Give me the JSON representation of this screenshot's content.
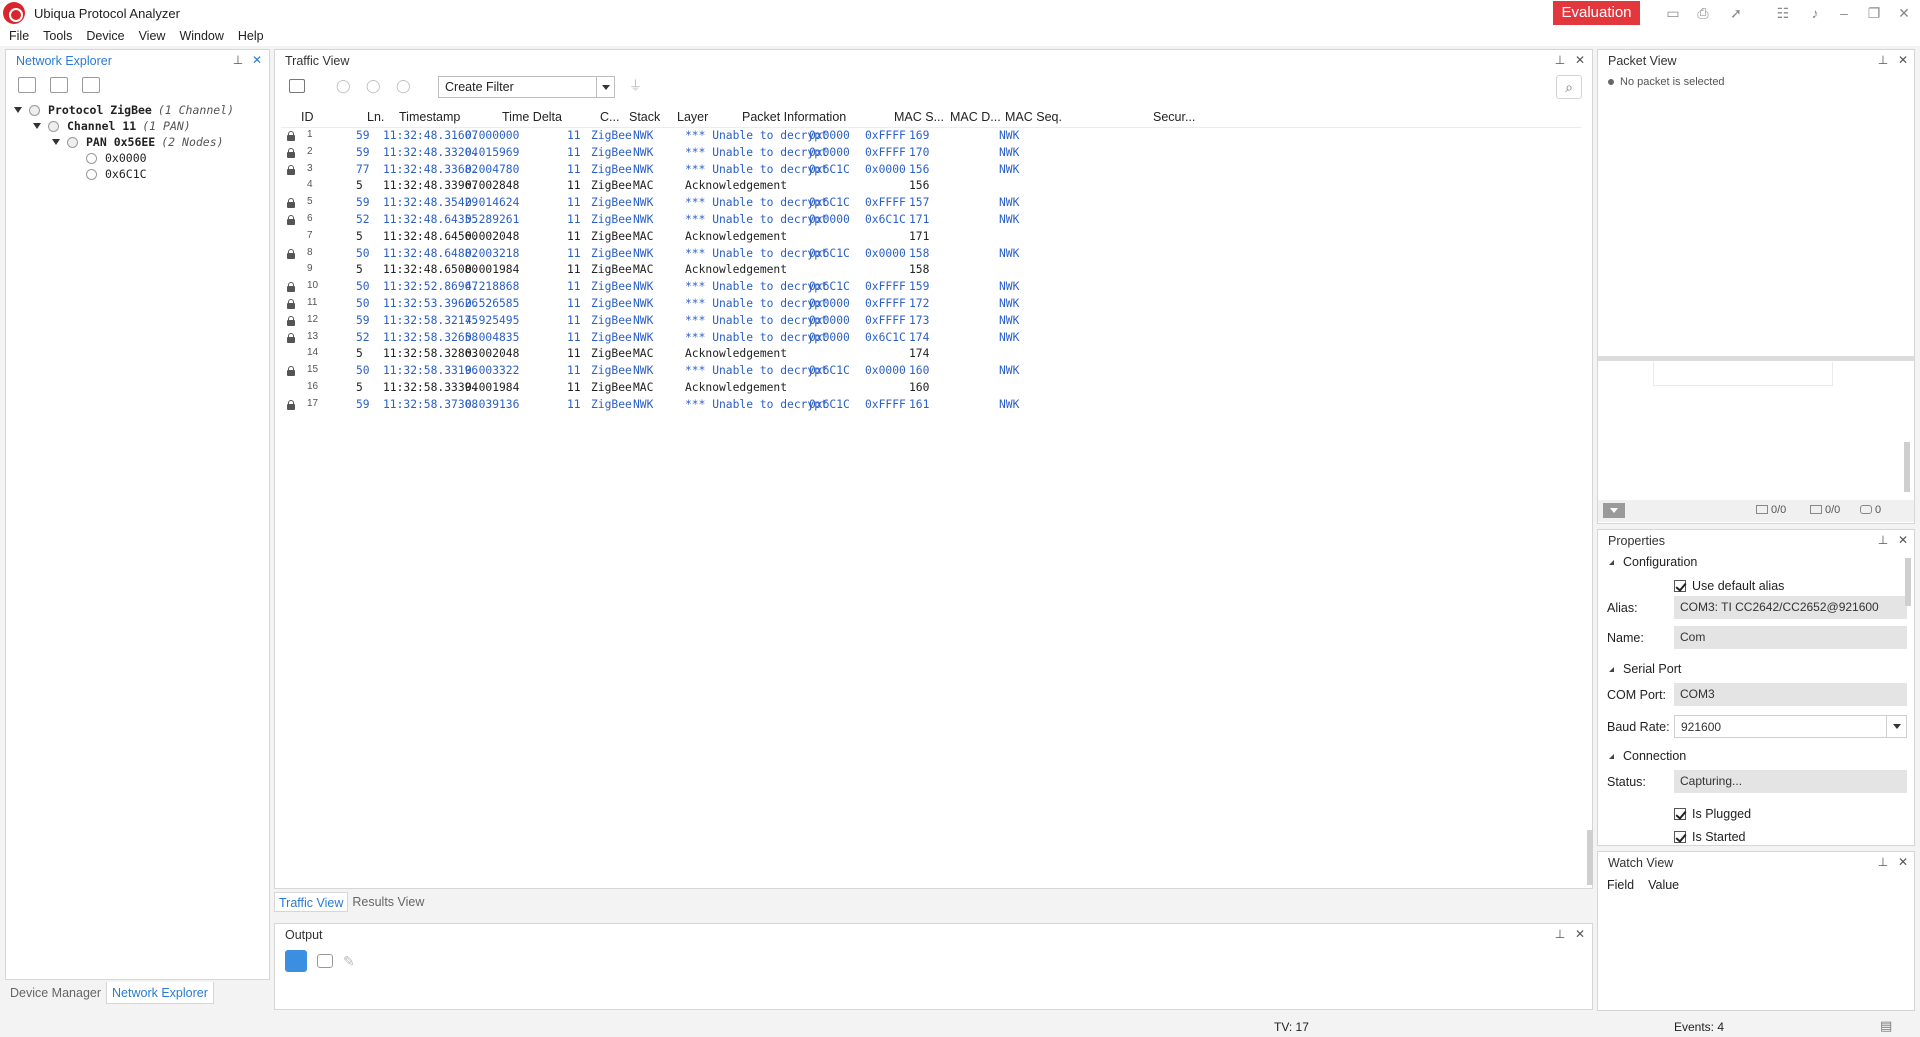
{
  "app": {
    "title": "Ubiqua Protocol Analyzer",
    "badge": "Evaluation",
    "accent_color": "#e2383d",
    "link_color": "#2a7ad5"
  },
  "menu": [
    "File",
    "Tools",
    "Device",
    "View",
    "Window",
    "Help"
  ],
  "network_explorer": {
    "title": "Network Explorer",
    "tree": {
      "protocol": {
        "name": "Protocol ZigBee",
        "meta": "(1 Channel)"
      },
      "channel": {
        "name": "Channel 11",
        "meta": "(1 PAN)"
      },
      "pan": {
        "name": "PAN 0x56EE",
        "meta": "(2 Nodes)"
      },
      "nodes": [
        "0x0000",
        "0x6C1C"
      ]
    }
  },
  "left_tabs": [
    "Device Manager",
    "Network Explorer"
  ],
  "traffic_view": {
    "title": "Traffic View",
    "filter_label": "Create Filter",
    "columns": [
      "ID",
      "Ln.",
      "Timestamp",
      "Time Delta",
      "C...",
      "Stack",
      "Layer",
      "Packet Information",
      "MAC S...",
      "MAC D...",
      "MAC Seq.",
      "Secur..."
    ],
    "rows": [
      {
        "id": "1",
        "locked": true,
        "len": "59",
        "ts": "11:32:48.31607",
        "delta": "0.000000",
        "ch": "11",
        "stack": "ZigBee",
        "layer": "NWK",
        "info": "*** Unable to decrypt…",
        "src": "0x0000",
        "dst": "0xFFFF",
        "seq": "169",
        "sec": "NWK"
      },
      {
        "id": "2",
        "locked": true,
        "len": "59",
        "ts": "11:32:48.33204",
        "delta": "0.015969",
        "ch": "11",
        "stack": "ZigBee",
        "layer": "NWK",
        "info": "*** Unable to decrypt…",
        "src": "0x0000",
        "dst": "0xFFFF",
        "seq": "170",
        "sec": "NWK"
      },
      {
        "id": "3",
        "locked": true,
        "len": "77",
        "ts": "11:32:48.33682",
        "delta": "0.004780",
        "ch": "11",
        "stack": "ZigBee",
        "layer": "NWK",
        "info": "*** Unable to decrypt…",
        "src": "0x6C1C",
        "dst": "0x0000",
        "seq": "156",
        "sec": "NWK"
      },
      {
        "id": "4",
        "locked": false,
        "len": "5",
        "ts": "11:32:48.33967",
        "delta": "0.002848",
        "ch": "11",
        "stack": "ZigBee",
        "layer": "MAC",
        "info": "Acknowledgement",
        "src": "",
        "dst": "",
        "seq": "156",
        "sec": ""
      },
      {
        "id": "5",
        "locked": true,
        "len": "59",
        "ts": "11:32:48.35429",
        "delta": "0.014624",
        "ch": "11",
        "stack": "ZigBee",
        "layer": "NWK",
        "info": "*** Unable to decrypt…",
        "src": "0x6C1C",
        "dst": "0xFFFF",
        "seq": "157",
        "sec": "NWK"
      },
      {
        "id": "6",
        "locked": true,
        "len": "52",
        "ts": "11:32:48.64355",
        "delta": "0.289261",
        "ch": "11",
        "stack": "ZigBee",
        "layer": "NWK",
        "info": "*** Unable to decrypt…",
        "src": "0x0000",
        "dst": "0x6C1C",
        "seq": "171",
        "sec": "NWK"
      },
      {
        "id": "7",
        "locked": false,
        "len": "5",
        "ts": "11:32:48.64560",
        "delta": "0.002048",
        "ch": "11",
        "stack": "ZigBee",
        "layer": "MAC",
        "info": "Acknowledgement",
        "src": "",
        "dst": "",
        "seq": "171",
        "sec": ""
      },
      {
        "id": "8",
        "locked": true,
        "len": "50",
        "ts": "11:32:48.64882",
        "delta": "0.003218",
        "ch": "11",
        "stack": "ZigBee",
        "layer": "NWK",
        "info": "*** Unable to decrypt…",
        "src": "0x6C1C",
        "dst": "0x0000",
        "seq": "158",
        "sec": "NWK"
      },
      {
        "id": "9",
        "locked": false,
        "len": "5",
        "ts": "11:32:48.65080",
        "delta": "0.001984",
        "ch": "11",
        "stack": "ZigBee",
        "layer": "MAC",
        "info": "Acknowledgement",
        "src": "",
        "dst": "",
        "seq": "158",
        "sec": ""
      },
      {
        "id": "10",
        "locked": true,
        "len": "50",
        "ts": "11:32:52.86967",
        "delta": "4.218868",
        "ch": "11",
        "stack": "ZigBee",
        "layer": "NWK",
        "info": "*** Unable to decrypt…",
        "src": "0x6C1C",
        "dst": "0xFFFF",
        "seq": "159",
        "sec": "NWK"
      },
      {
        "id": "11",
        "locked": true,
        "len": "50",
        "ts": "11:32:53.39626",
        "delta": "0.526585",
        "ch": "11",
        "stack": "ZigBee",
        "layer": "NWK",
        "info": "*** Unable to decrypt…",
        "src": "0x0000",
        "dst": "0xFFFF",
        "seq": "172",
        "sec": "NWK"
      },
      {
        "id": "12",
        "locked": true,
        "len": "59",
        "ts": "11:32:58.32175",
        "delta": "4.925495",
        "ch": "11",
        "stack": "ZigBee",
        "layer": "NWK",
        "info": "*** Unable to decrypt…",
        "src": "0x0000",
        "dst": "0xFFFF",
        "seq": "173",
        "sec": "NWK"
      },
      {
        "id": "13",
        "locked": true,
        "len": "52",
        "ts": "11:32:58.32658",
        "delta": "0.004835",
        "ch": "11",
        "stack": "ZigBee",
        "layer": "NWK",
        "info": "*** Unable to decrypt…",
        "src": "0x0000",
        "dst": "0x6C1C",
        "seq": "174",
        "sec": "NWK"
      },
      {
        "id": "14",
        "locked": false,
        "len": "5",
        "ts": "11:32:58.32863",
        "delta": "0.002048",
        "ch": "11",
        "stack": "ZigBee",
        "layer": "MAC",
        "info": "Acknowledgement",
        "src": "",
        "dst": "",
        "seq": "174",
        "sec": ""
      },
      {
        "id": "15",
        "locked": true,
        "len": "50",
        "ts": "11:32:58.33196",
        "delta": "0.003322",
        "ch": "11",
        "stack": "ZigBee",
        "layer": "NWK",
        "info": "*** Unable to decrypt…",
        "src": "0x6C1C",
        "dst": "0x0000",
        "seq": "160",
        "sec": "NWK"
      },
      {
        "id": "16",
        "locked": false,
        "len": "5",
        "ts": "11:32:58.33394",
        "delta": "0.001984",
        "ch": "11",
        "stack": "ZigBee",
        "layer": "MAC",
        "info": "Acknowledgement",
        "src": "",
        "dst": "",
        "seq": "160",
        "sec": ""
      },
      {
        "id": "17",
        "locked": true,
        "len": "59",
        "ts": "11:32:58.37308",
        "delta": "0.039136",
        "ch": "11",
        "stack": "ZigBee",
        "layer": "NWK",
        "info": "*** Unable to decrypt…",
        "src": "0x6C1C",
        "dst": "0xFFFF",
        "seq": "161",
        "sec": "NWK"
      }
    ]
  },
  "traffic_tabs": [
    "Traffic View",
    "Results View"
  ],
  "output": {
    "title": "Output"
  },
  "status": {
    "tv": "TV: 17",
    "events": "Events: 4"
  },
  "packet_view": {
    "title": "Packet View",
    "empty_text": "No packet is selected",
    "count_a": "0/0",
    "count_b": "0/0",
    "count_c": "0"
  },
  "properties": {
    "title": "Properties",
    "sections": {
      "configuration": "Configuration",
      "serial_port": "Serial Port",
      "connection": "Connection"
    },
    "use_default_alias": {
      "label": "Use default alias",
      "checked": true
    },
    "alias": {
      "label": "Alias:",
      "value": "COM3: TI CC2642/CC2652@921600"
    },
    "name": {
      "label": "Name:",
      "value": "Com"
    },
    "com_port": {
      "label": "COM Port:",
      "value": "COM3"
    },
    "baud_rate": {
      "label": "Baud Rate:",
      "value": "921600"
    },
    "status": {
      "label": "Status:",
      "value": "Capturing..."
    },
    "is_plugged": {
      "label": "Is Plugged",
      "checked": true
    },
    "is_started": {
      "label": "Is Started",
      "checked": true
    }
  },
  "watch_view": {
    "title": "Watch View",
    "columns": [
      "Field",
      "Value"
    ]
  }
}
